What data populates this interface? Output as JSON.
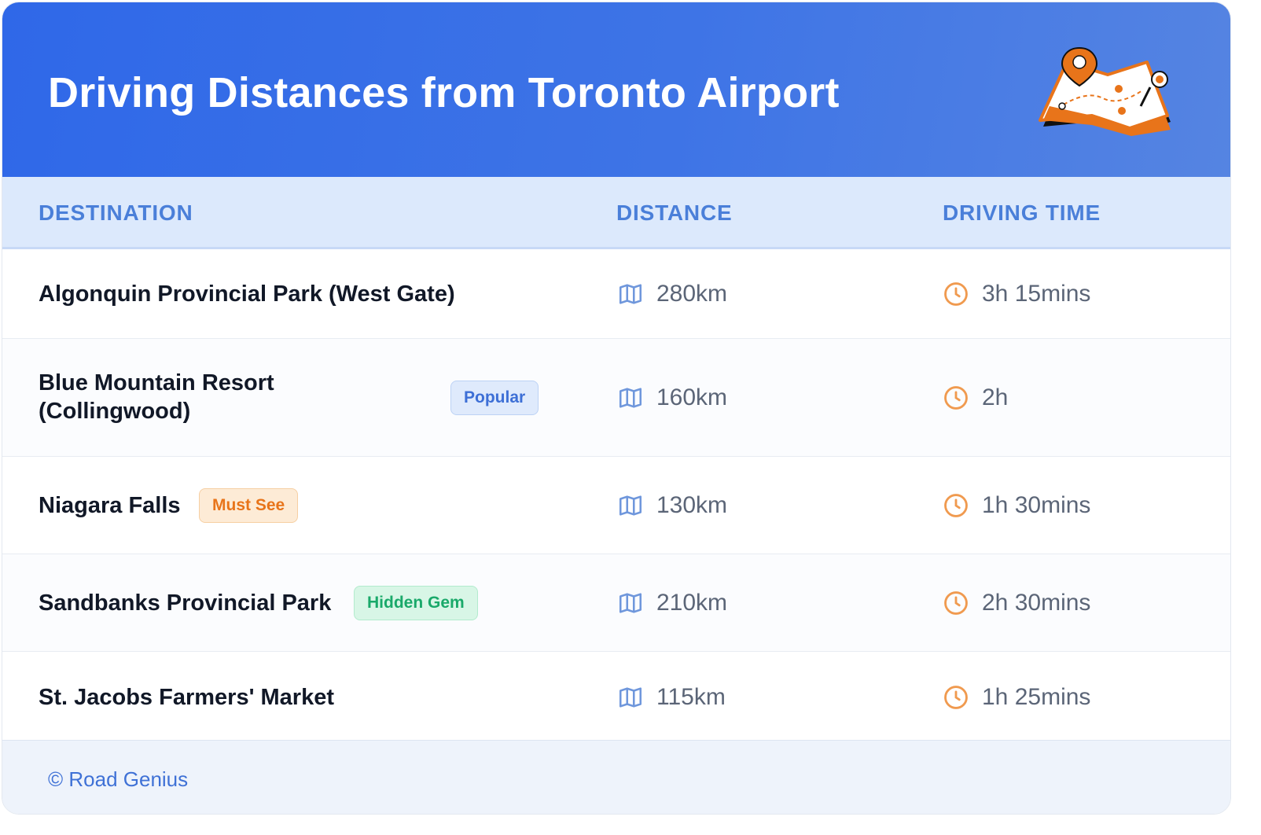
{
  "header": {
    "title": "Driving Distances from Toronto Airport"
  },
  "columns": {
    "destination": "DESTINATION",
    "distance": "DISTANCE",
    "driving_time": "DRIVING TIME"
  },
  "rows": [
    {
      "destination": "Algonquin Provincial Park (West Gate)",
      "badge": "",
      "distance": "280km",
      "time": "3h 15mins"
    },
    {
      "destination_line1": "Blue Mountain Resort",
      "destination_line2": "(Collingwood)",
      "badge": "Popular",
      "distance": "160km",
      "time": "2h"
    },
    {
      "destination": "Niagara Falls",
      "badge": "Must See",
      "distance": "130km",
      "time": "1h 30mins"
    },
    {
      "destination": "Sandbanks Provincial Park",
      "badge": "Hidden Gem",
      "distance": "210km",
      "time": "2h 30mins"
    },
    {
      "destination": "St. Jacobs Farmers' Market",
      "badge": "",
      "distance": "115km",
      "time": "1h 25mins"
    }
  ],
  "icons": {
    "distance": "map-icon",
    "time": "clock-icon",
    "header": "map-pin-illustration"
  },
  "colors": {
    "accent": "#2f68e8",
    "icon_blue": "#6f97dc",
    "icon_orange": "#f09a4f"
  },
  "footer": {
    "credit": "© Road Genius"
  }
}
